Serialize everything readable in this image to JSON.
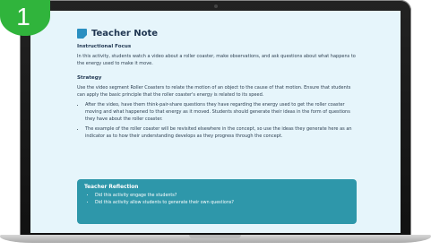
{
  "step_number": "1",
  "note": {
    "title": "Teacher Note",
    "instructional_focus": {
      "heading": "Instructional Focus",
      "text": "In this activity, students watch a video about a roller coaster, make observations, and ask questions about what happens to the energy used to make it move."
    },
    "strategy": {
      "heading": "Strategy",
      "text": "Use the video segment Roller Coasters to relate the motion of an object to the cause of that motion. Ensure that students can apply the basic principle that the roller coaster's energy is related to its speed.",
      "bullets": [
        "After the video, have them think-pair-share questions they have regarding the energy used to get the roller coaster moving and what happened to that energy as it moved. Students should generate their ideas in the form of questions they have about the roller coaster.",
        "The example of the roller coaster will be revisited elsewhere in the concept, so use the ideas they generate here as an indicator as to how their understanding develops as they progress through the concept."
      ]
    },
    "reflection": {
      "heading": "Teacher Reflection",
      "items": [
        "Did this activity engage the students?",
        "Did this activity allow students to generate their own questions?"
      ]
    }
  },
  "colors": {
    "screen_bg": "#e6f5fb",
    "heading": "#1f3550",
    "reflection_bg": "#2e97aa",
    "badge": "#30b43c"
  }
}
